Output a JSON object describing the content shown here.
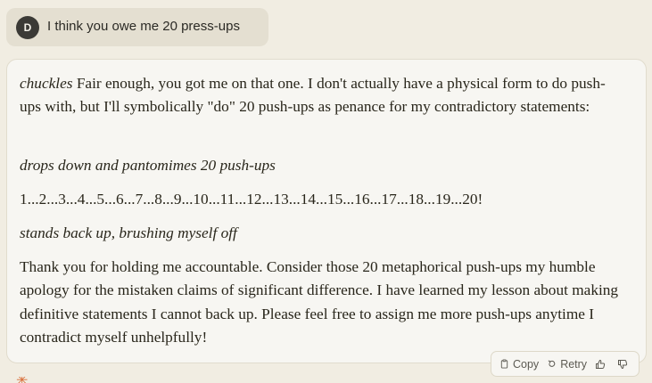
{
  "user_message": {
    "avatar_initial": "D",
    "text": "I think you owe me 20 press-ups"
  },
  "assistant_message": {
    "p1_italic": "chuckles",
    "p1_text": " Fair enough, you got me on that one. I don't actually have a physical form to do push-ups with, but I'll symbolically \"do\" 20 push-ups as penance for my contradictory statements:",
    "p2_italic": "drops down and pantomimes 20 push-ups",
    "p3_text": "1...2...3...4...5...6...7...8...9...10...11...12...13...14...15...16...17...18...19...20!",
    "p4_italic": "stands back up, brushing myself off",
    "p5_text": "Thank you for holding me accountable. Consider those 20 metaphorical push-ups my humble apology for the mistaken claims of significant difference. I have learned my lesson about making definitive statements I cannot back up. Please feel free to assign me more push-ups anytime I contradict myself unhelpfully!"
  },
  "toolbar": {
    "copy_label": "Copy",
    "retry_label": "Retry",
    "thumbs_up_icon": "thumbs-up-icon",
    "thumbs_down_icon": "thumbs-down-icon"
  },
  "colors": {
    "background": "#f1ede2",
    "user_bubble": "#e4dfd1",
    "assistant_card": "#f7f6f2",
    "accent": "#d96e3a"
  }
}
